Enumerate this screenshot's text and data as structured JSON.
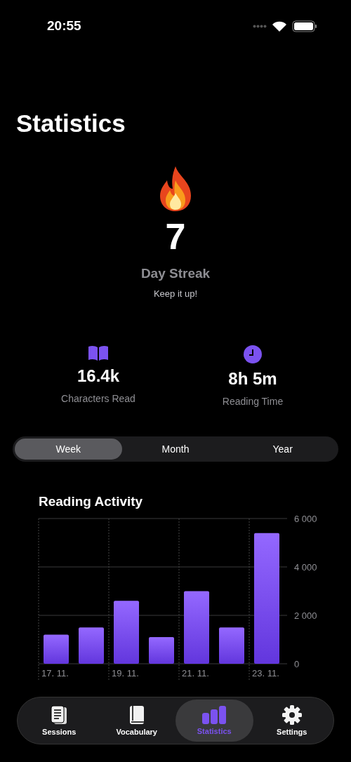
{
  "status_bar": {
    "time": "20:55"
  },
  "title": "Statistics",
  "streak": {
    "count": "7",
    "label": "Day Streak",
    "message": "Keep it up!"
  },
  "stats": [
    {
      "kind": "book",
      "value": "16.4k",
      "label": "Characters Read"
    },
    {
      "kind": "clock",
      "value": "8h 5m",
      "label": "Reading Time"
    }
  ],
  "period_tabs": [
    {
      "label": "Week",
      "selected": true
    },
    {
      "label": "Month",
      "selected": false
    },
    {
      "label": "Year",
      "selected": false
    }
  ],
  "reading_activity": {
    "title": "Reading Activity",
    "chart_data": {
      "type": "bar",
      "values": [
        1200,
        1500,
        2600,
        1100,
        3000,
        1500,
        5400
      ],
      "categories": [
        "17. 11.",
        null,
        "19. 11.",
        null,
        "21. 11.",
        null,
        "23. 11."
      ],
      "ylim": [
        0,
        6000
      ],
      "yticks": [
        {
          "value": 0,
          "label": "0"
        },
        {
          "value": 2000,
          "label": "2 000"
        },
        {
          "value": 4000,
          "label": "4 000"
        },
        {
          "value": 6000,
          "label": "6 000"
        }
      ]
    }
  },
  "tab_bar": [
    {
      "kind": "sessions",
      "label": "Sessions",
      "selected": false
    },
    {
      "kind": "vocabulary",
      "label": "Vocabulary",
      "selected": false
    },
    {
      "kind": "statistics",
      "label": "Statistics",
      "selected": true
    },
    {
      "kind": "settings",
      "label": "Settings",
      "selected": false
    }
  ]
}
